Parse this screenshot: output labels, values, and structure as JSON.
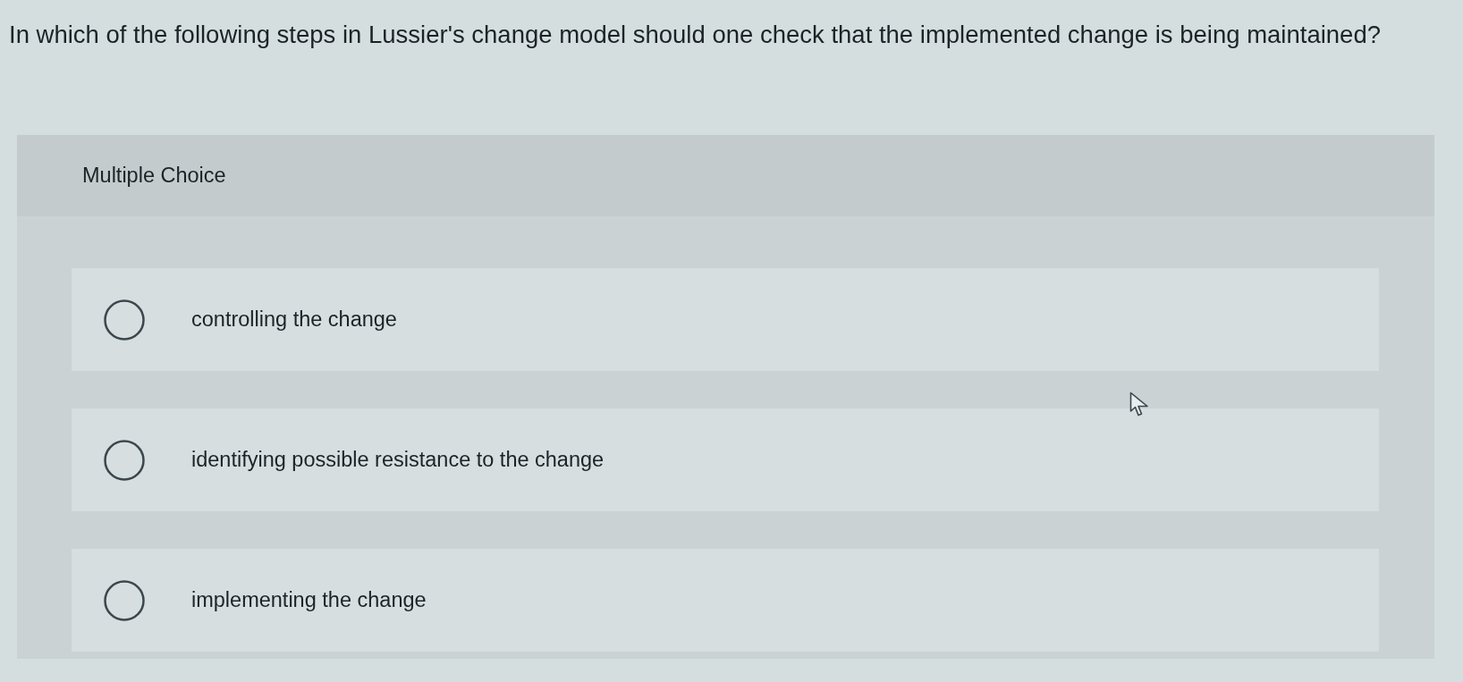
{
  "question": {
    "text": "In which of the following steps in Lussier's change model should one check that the implemented change is being maintained?"
  },
  "panel": {
    "heading": "Multiple Choice",
    "options": [
      {
        "label": "controlling the change",
        "selected": false
      },
      {
        "label": "identifying possible resistance to the change",
        "selected": false
      },
      {
        "label": "implementing the change",
        "selected": false
      }
    ]
  }
}
